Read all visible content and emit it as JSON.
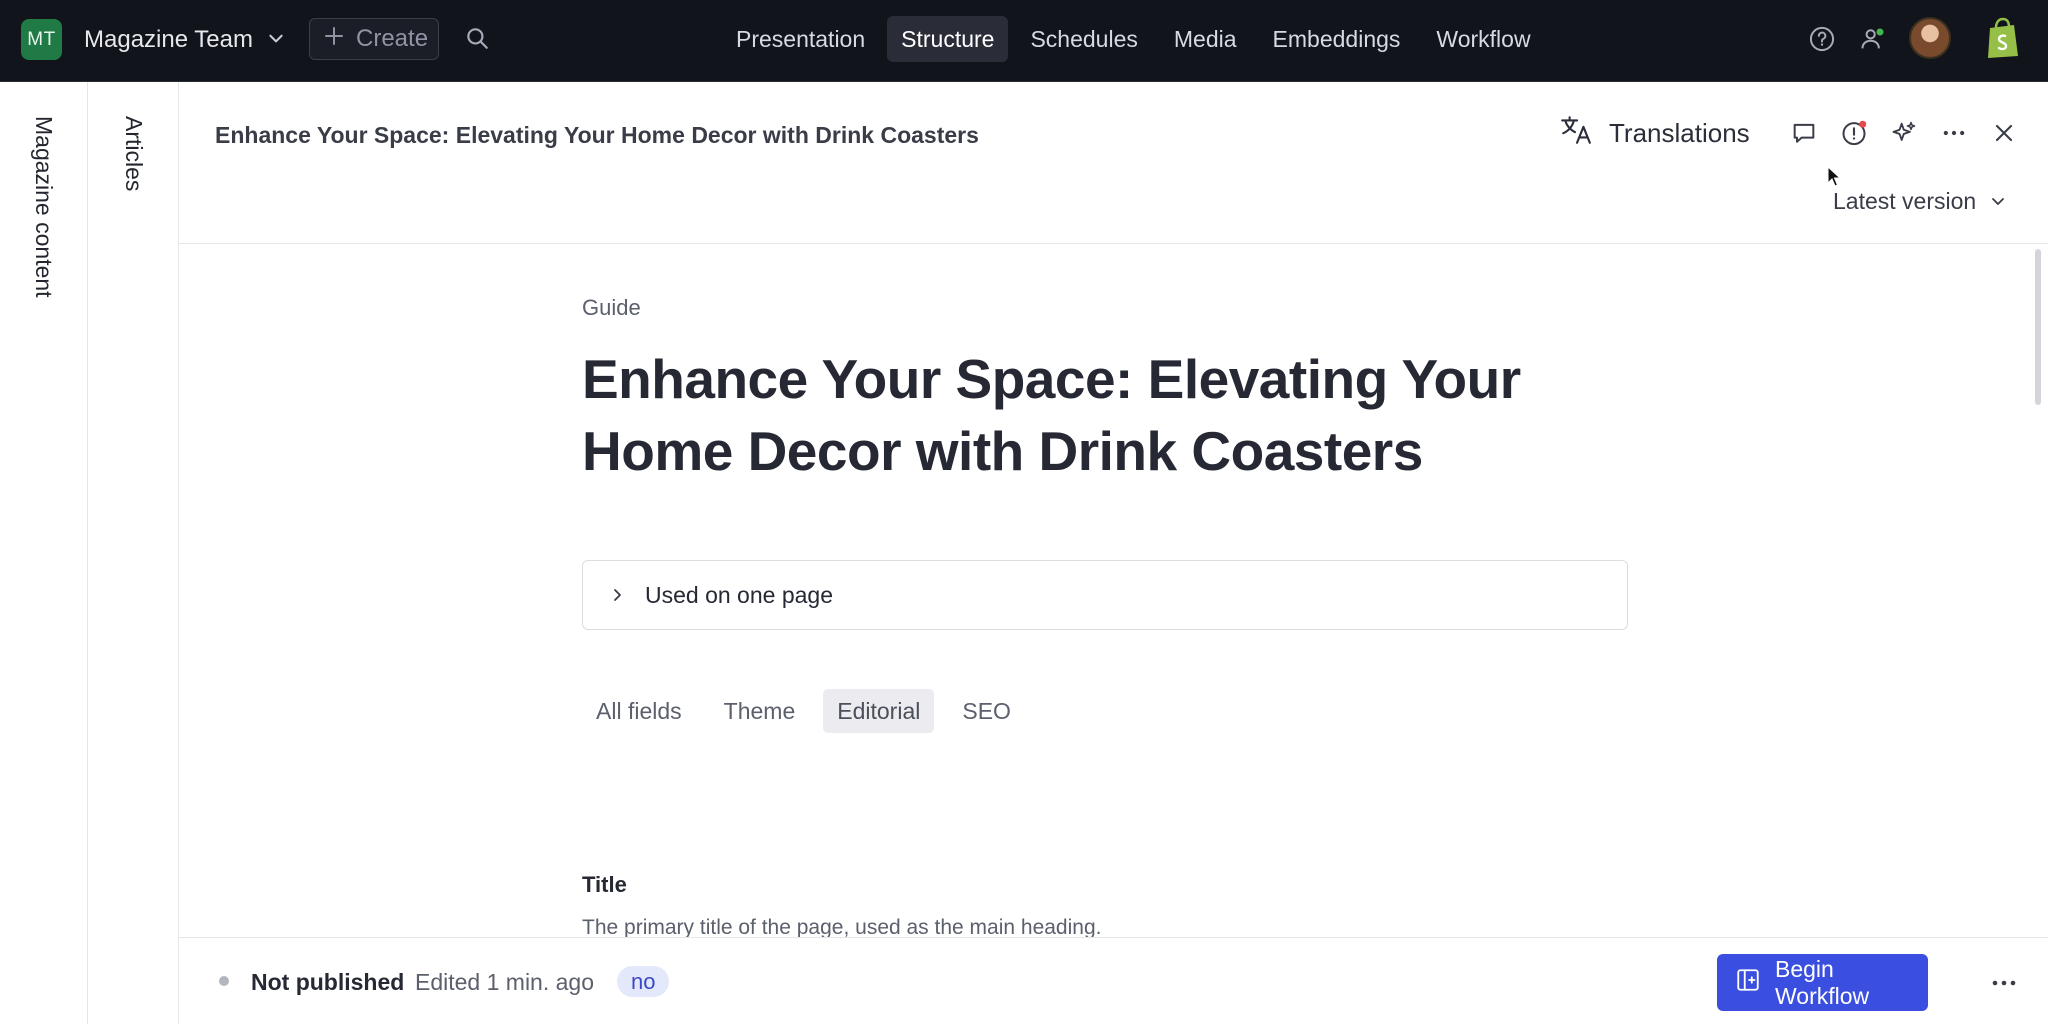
{
  "topbar": {
    "workspace_initials": "MT",
    "workspace_name": "Magazine Team",
    "create_label": "Create",
    "nav": [
      {
        "label": "Presentation",
        "active": false
      },
      {
        "label": "Structure",
        "active": true
      },
      {
        "label": "Schedules",
        "active": false
      },
      {
        "label": "Media",
        "active": false
      },
      {
        "label": "Embeddings",
        "active": false
      },
      {
        "label": "Workflow",
        "active": false
      }
    ],
    "icons": [
      "help-icon",
      "users-icon",
      "avatar",
      "shopify-icon"
    ]
  },
  "rails": {
    "primary": "Magazine content",
    "secondary": "Articles"
  },
  "document": {
    "header_title": "Enhance Your Space: Elevating Your Home Decor with Drink Coasters",
    "translations_label": "Translations",
    "version_label": "Latest version",
    "header_icons": [
      "comment-icon",
      "alert-icon",
      "sparkle-icon",
      "more-icon",
      "close-icon"
    ]
  },
  "content": {
    "doc_type": "Guide",
    "title": "Enhance Your Space: Elevating Your Home Decor with Drink Coasters",
    "used_on": "Used on one page",
    "tabs": [
      {
        "label": "All fields",
        "active": false
      },
      {
        "label": "Theme",
        "active": false
      },
      {
        "label": "Editorial",
        "active": true
      },
      {
        "label": "SEO",
        "active": false
      }
    ],
    "field_label": "Title",
    "field_description": "The primary title of the page, used as the main heading."
  },
  "footer": {
    "status": "Not published",
    "edited": "Edited 1 min. ago",
    "language_badge": "no",
    "begin_workflow_label": "Begin Workflow"
  },
  "colors": {
    "topbar_bg": "#12141c",
    "accent": "#3a4fe0",
    "workspace_badge": "#1f7a45",
    "shopify_green": "#95bf47",
    "notification_red": "#e5484d"
  }
}
